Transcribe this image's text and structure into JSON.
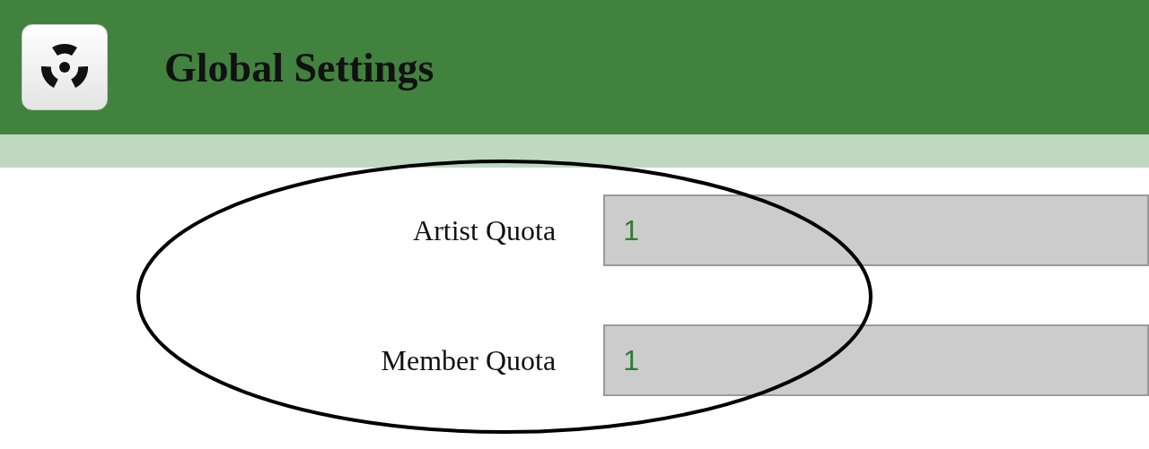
{
  "header": {
    "title": "Global Settings"
  },
  "fields": [
    {
      "label": "Artist Quota",
      "value": "1"
    },
    {
      "label": "Member Quota",
      "value": "1"
    }
  ]
}
